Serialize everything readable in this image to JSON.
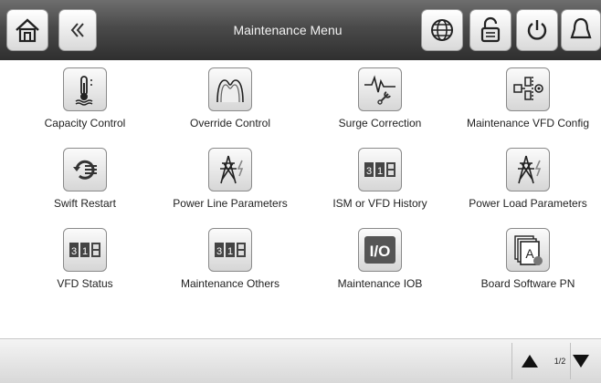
{
  "header": {
    "title": "Maintenance Menu",
    "buttons": [
      "home-icon",
      "back-icon",
      "globe-icon",
      "lock-icon",
      "power-icon",
      "bell-icon"
    ]
  },
  "menu": {
    "items": [
      {
        "label": "Capacity Control",
        "icon": "thermometer-icon"
      },
      {
        "label": "Override Control",
        "icon": "override-icon"
      },
      {
        "label": "Surge Correction",
        "icon": "surge-wrench-icon"
      },
      {
        "label": "Maintenance VFD Config",
        "icon": "vfd-config-icon"
      },
      {
        "label": "Swift Restart",
        "icon": "restart-icon"
      },
      {
        "label": "Power Line Parameters",
        "icon": "power-tower-icon"
      },
      {
        "label": "ISM or VFD History",
        "icon": "calendar-icon"
      },
      {
        "label": "Power Load Parameters",
        "icon": "power-tower-icon"
      },
      {
        "label": "VFD Status",
        "icon": "calendar-icon"
      },
      {
        "label": "Maintenance Others",
        "icon": "calendar-icon"
      },
      {
        "label": "Maintenance IOB",
        "icon": "io-icon"
      },
      {
        "label": "Board Software PN",
        "icon": "software-doc-icon"
      }
    ],
    "calendar_digits": [
      "3",
      "1"
    ],
    "io_text": "I/O",
    "doc_letter": "A"
  },
  "footer": {
    "page": "1/2",
    "icons": [
      "arrow-up-icon",
      "arrow-down-icon"
    ]
  },
  "colors": {
    "header_dark": "#2f2f2f",
    "header_light": "#6e6e6e",
    "io_bg": "#555555"
  }
}
